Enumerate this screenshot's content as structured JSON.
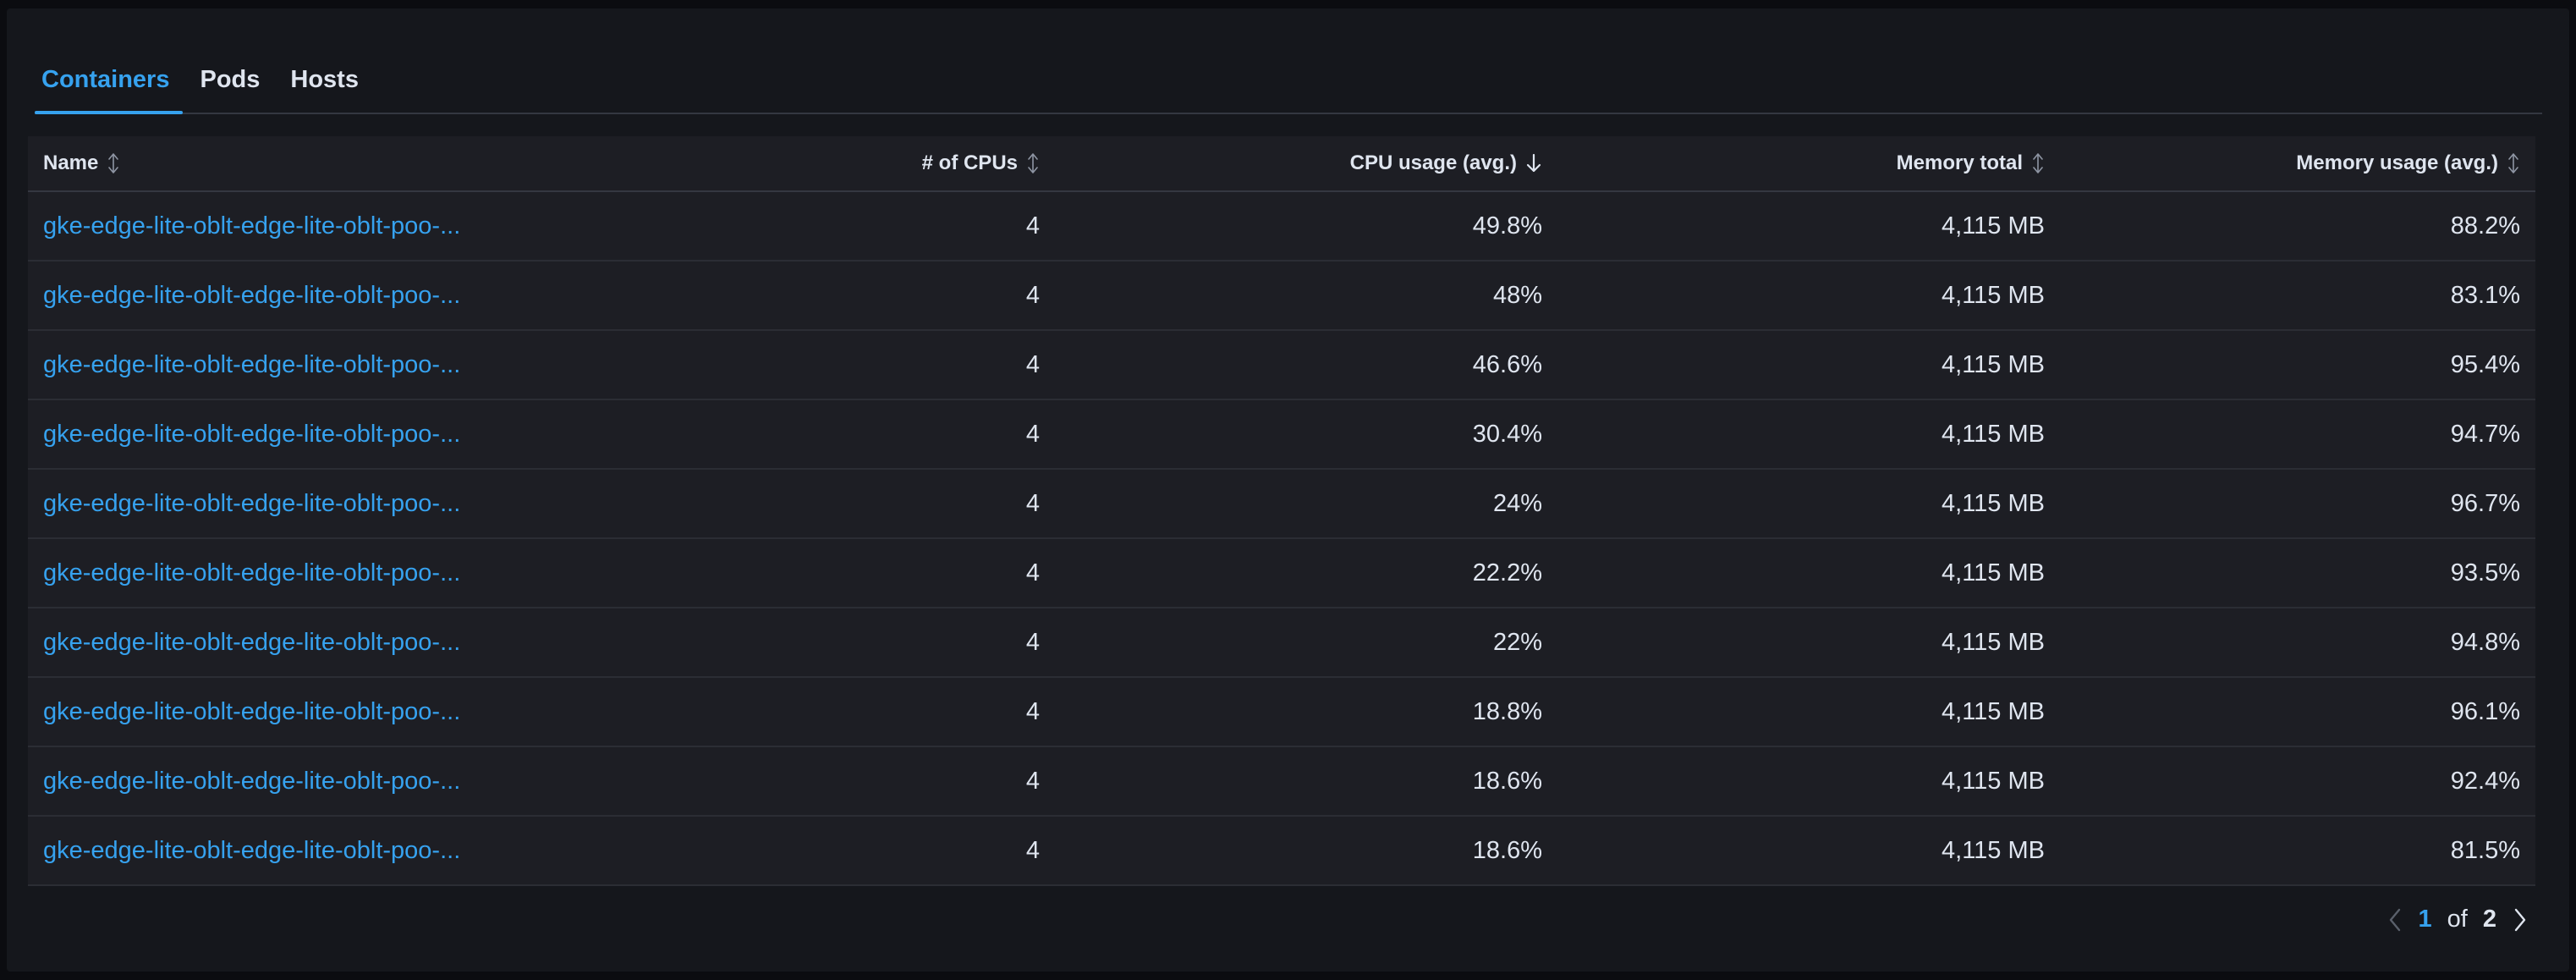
{
  "tabs": [
    {
      "label": "Containers",
      "active": true
    },
    {
      "label": "Pods",
      "active": false
    },
    {
      "label": "Hosts",
      "active": false
    }
  ],
  "table": {
    "columns": [
      "Name",
      "# of CPUs",
      "CPU usage (avg.)",
      "Memory total",
      "Memory usage (avg.)"
    ],
    "sorted_column": "CPU usage (avg.)",
    "sort_direction": "descending",
    "rows": [
      [
        "gke-edge-lite-oblt-edge-lite-oblt-poo-...",
        "4",
        "49.8%",
        "4,115 MB",
        "88.2%"
      ],
      [
        "gke-edge-lite-oblt-edge-lite-oblt-poo-...",
        "4",
        "48%",
        "4,115 MB",
        "83.1%"
      ],
      [
        "gke-edge-lite-oblt-edge-lite-oblt-poo-...",
        "4",
        "46.6%",
        "4,115 MB",
        "95.4%"
      ],
      [
        "gke-edge-lite-oblt-edge-lite-oblt-poo-...",
        "4",
        "30.4%",
        "4,115 MB",
        "94.7%"
      ],
      [
        "gke-edge-lite-oblt-edge-lite-oblt-poo-...",
        "4",
        "24%",
        "4,115 MB",
        "96.7%"
      ],
      [
        "gke-edge-lite-oblt-edge-lite-oblt-poo-...",
        "4",
        "22.2%",
        "4,115 MB",
        "93.5%"
      ],
      [
        "gke-edge-lite-oblt-edge-lite-oblt-poo-...",
        "4",
        "22%",
        "4,115 MB",
        "94.8%"
      ],
      [
        "gke-edge-lite-oblt-edge-lite-oblt-poo-...",
        "4",
        "18.8%",
        "4,115 MB",
        "96.1%"
      ],
      [
        "gke-edge-lite-oblt-edge-lite-oblt-poo-...",
        "4",
        "18.6%",
        "4,115 MB",
        "92.4%"
      ],
      [
        "gke-edge-lite-oblt-edge-lite-oblt-poo-...",
        "4",
        "18.6%",
        "4,115 MB",
        "81.5%"
      ]
    ]
  },
  "pagination": {
    "current": "1",
    "of_label": "of",
    "total": "2"
  },
  "icons": {
    "sort": "sort-icon",
    "sort_desc": "arrow-down-icon",
    "prev": "chevron-left-icon",
    "next": "chevron-right-icon"
  },
  "colors": {
    "accent": "#36a2ef",
    "panel": "#15171c",
    "table_bg": "#1d1e24",
    "border": "#343741"
  }
}
